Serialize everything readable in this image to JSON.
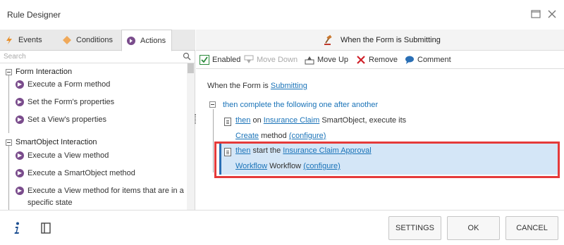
{
  "window": {
    "title": "Rule Designer"
  },
  "tabs": [
    {
      "label": "Events",
      "icon": "lightning-icon"
    },
    {
      "label": "Conditions",
      "icon": "diamond-icon"
    },
    {
      "label": "Actions",
      "icon": "arrow-circle-icon"
    }
  ],
  "search": {
    "placeholder": "Search"
  },
  "tree": {
    "groups": [
      {
        "label": "Form Interaction",
        "items": [
          "Execute a Form method",
          "Set the Form's properties",
          "Set a View's properties"
        ]
      },
      {
        "label": "SmartObject Interaction",
        "items": [
          "Execute a View method",
          "Execute a SmartObject method",
          "Execute a View method for items that are in a specific state"
        ]
      }
    ]
  },
  "header": {
    "label": "When the Form is Submitting"
  },
  "toolbar": {
    "enabled": "Enabled",
    "move_down": "Move Down",
    "move_up": "Move Up",
    "remove": "Remove",
    "comment": "Comment"
  },
  "rule": {
    "event_prefix": "When the Form is",
    "event_link": "Submitting",
    "sequence": "then complete the following one after another",
    "action1": {
      "then": "then",
      "on": "on",
      "smartobject": "Insurance Claim",
      "suffix": "SmartObject, execute its",
      "method": "Create",
      "method_word": "method",
      "configure": "(configure)"
    },
    "action2": {
      "then": "then",
      "start": "start the",
      "workflow_name": "Insurance Claim Approval",
      "workflow_link": "Workflow",
      "workflow_word": "Workflow",
      "configure": "(configure)"
    }
  },
  "footer": {
    "settings": "SETTINGS",
    "ok": "OK",
    "cancel": "CANCEL"
  },
  "colors": {
    "link": "#1a73b8",
    "selection": "#d4e6f7",
    "highlight_border": "#e53a3a",
    "action_icon": "#7a4c8c"
  }
}
